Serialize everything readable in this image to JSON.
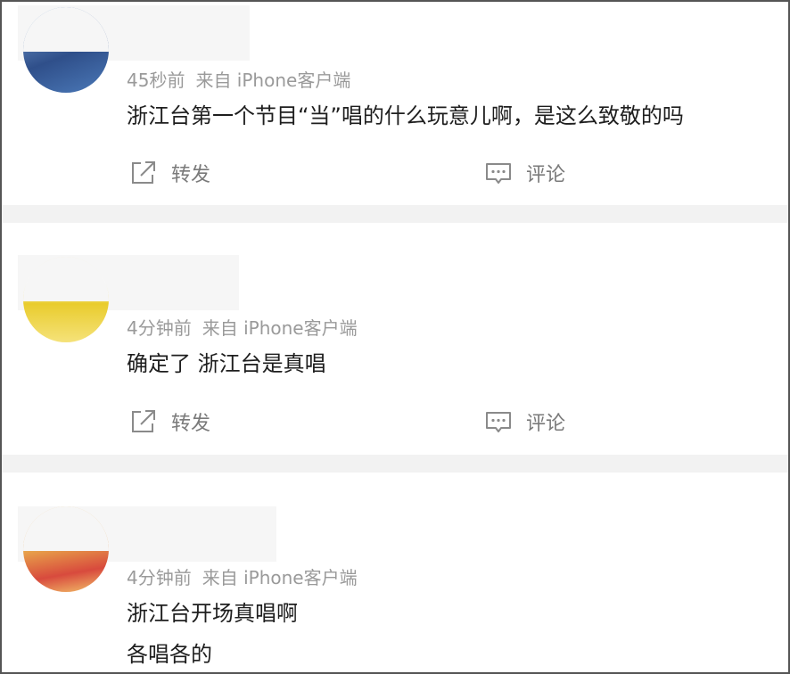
{
  "posts": [
    {
      "time": "45秒前",
      "source": "来自 iPhone客户端",
      "lines": [
        "浙江台第一个节目“当”唱的什么玩意儿啊，是这么致敬的吗"
      ],
      "avatar_colors": [
        "#2f4f8a",
        "#4b79b8"
      ],
      "repost_label": "转发",
      "comment_label": "评论"
    },
    {
      "time": "4分钟前",
      "source": "来自 iPhone客户端",
      "lines": [
        "确定了 浙江台是真唱"
      ],
      "avatar_colors": [
        "#e9cc2d",
        "#f5e27a"
      ],
      "repost_label": "转发",
      "comment_label": "评论"
    },
    {
      "time": "4分钟前",
      "source": "来自 iPhone客户端",
      "lines": [
        "浙江台开场真唱啊",
        "各唱各的"
      ],
      "avatar_colors": [
        "#e8a34a",
        "#d84a3d"
      ]
    }
  ],
  "colors": {
    "meta_text": "#9a9a9a",
    "body_text": "#1e1e1e",
    "action_text": "#7a7a7a",
    "divider": "#f2f2f2",
    "frame_border": "#555555"
  },
  "icons": [
    "share-icon",
    "comment-icon"
  ]
}
